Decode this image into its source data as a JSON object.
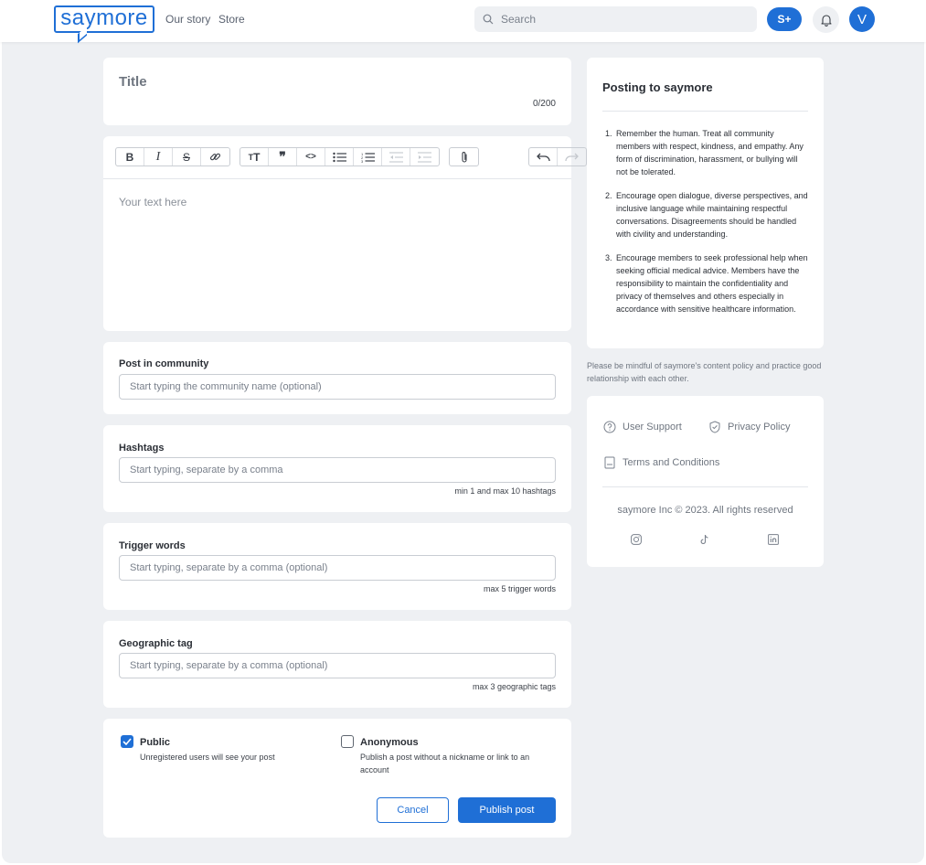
{
  "header": {
    "logo_text": "saymore",
    "nav": [
      {
        "label": "Our story"
      },
      {
        "label": "Store"
      }
    ],
    "search_placeholder": "Search",
    "subscription_label": "S+",
    "avatar_initial": "V",
    "icons": {
      "search": "search-icon",
      "bell": "bell-icon"
    }
  },
  "title_card": {
    "placeholder": "Title",
    "counter": "0/200"
  },
  "editor": {
    "toolbar": [
      {
        "name": "bold",
        "glyph": "B"
      },
      {
        "name": "italic",
        "glyph": "I"
      },
      {
        "name": "strikethrough",
        "glyph": "S"
      },
      {
        "name": "link",
        "glyph": "🔗"
      },
      {
        "name": "heading",
        "glyph": "T"
      },
      {
        "name": "quote",
        "glyph": "❞"
      },
      {
        "name": "code",
        "glyph": "<>"
      },
      {
        "name": "bullet-list",
        "glyph": "≣"
      },
      {
        "name": "numbered-list",
        "glyph": "≣"
      },
      {
        "name": "outdent",
        "glyph": "⇤"
      },
      {
        "name": "indent",
        "glyph": "⇥"
      },
      {
        "name": "attachment",
        "glyph": "📎"
      },
      {
        "name": "undo",
        "glyph": "↶"
      },
      {
        "name": "redo",
        "glyph": "↷"
      }
    ],
    "placeholder": "Your text here"
  },
  "community": {
    "label": "Post in community",
    "placeholder": "Start typing the community name (optional)"
  },
  "hashtags": {
    "label": "Hashtags",
    "placeholder": "Start typing, separate by a comma",
    "hint": "min 1 and max 10 hashtags"
  },
  "trigger_words": {
    "label": "Trigger words",
    "placeholder": "Start typing, separate by a comma (optional)",
    "hint": "max 5 trigger words"
  },
  "geo_tag": {
    "label": "Geographic tag",
    "placeholder": "Start typing, separate by a comma (optional)",
    "hint": "max 3 geographic tags"
  },
  "visibility": {
    "public": {
      "label": "Public",
      "description": "Unregistered users will see your post",
      "checked": true
    },
    "anonymous": {
      "label": "Anonymous",
      "description": "Publish a post without a nickname or link to an account",
      "checked": false
    },
    "cancel_label": "Cancel",
    "publish_label": "Publish post"
  },
  "rules": {
    "title": "Posting to saymore",
    "items": [
      {
        "num": "1.",
        "text": "Remember the human. Treat all community members with respect, kindness, and empathy. Any form of discrimination, harassment, or bullying will not be tolerated."
      },
      {
        "num": "2.",
        "text": "Encourage open dialogue, diverse perspectives, and inclusive language while maintaining respectful conversations. Disagreements should be handled with civility and understanding."
      },
      {
        "num": "3.",
        "text": "Encourage members to seek professional help when seeking official medical advice. Members have the responsibility to maintain the confidentiality and privacy of themselves and others especially in accordance with sensitive healthcare information."
      }
    ]
  },
  "mindful_note": "Please be mindful of saymore's content policy and practice good relationship with each other.",
  "footer": {
    "links": [
      {
        "label": "User Support",
        "icon": "help-circle-icon"
      },
      {
        "label": "Privacy Policy",
        "icon": "shield-check-icon"
      },
      {
        "label": "Terms and Conditions",
        "icon": "document-icon"
      }
    ],
    "copyright": "saymore Inc © 2023. All rights reserved",
    "social": [
      "instagram-icon",
      "tiktok-icon",
      "linkedin-icon"
    ]
  },
  "colors": {
    "accent": "#1f6fd6",
    "background": "#eef0f3",
    "card": "#ffffff"
  }
}
